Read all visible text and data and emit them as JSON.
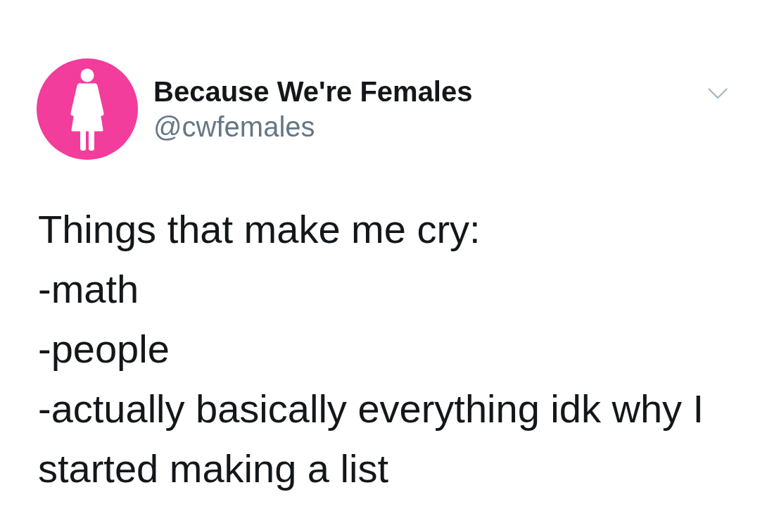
{
  "tweet": {
    "author": {
      "name": "Because We're Females",
      "handle": "@cwfemales"
    },
    "text": "Things that make me cry:\n-math\n-people\n-actually basically everything idk why I started making a list"
  }
}
